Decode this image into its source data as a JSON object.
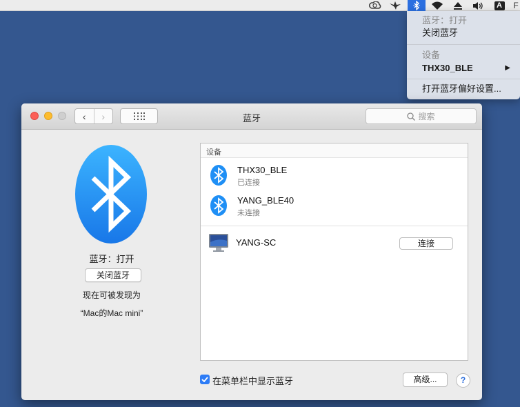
{
  "menubar": {
    "icons": [
      "creative-cloud-icon",
      "bird-icon",
      "bluetooth-icon",
      "wifi-icon",
      "eject-icon",
      "volume-icon",
      "input-source-icon"
    ],
    "input_source_label": "A",
    "extra_label": "F"
  },
  "dropdown": {
    "status": "蓝牙：打开",
    "toggle": "关闭蓝牙",
    "devices_header": "设备",
    "device": "THX30_BLE",
    "open_prefs": "打开蓝牙偏好设置..."
  },
  "window": {
    "title": "蓝牙",
    "search_placeholder": "搜索"
  },
  "left": {
    "status": "蓝牙：打开",
    "toggle_button": "关闭蓝牙",
    "discoverable_line1": "现在可被发现为",
    "discoverable_line2": "“Mac的Mac mini”"
  },
  "devices": {
    "header": "设备",
    "items": [
      {
        "name": "THX30_BLE",
        "status": "已连接"
      },
      {
        "name": "YANG_BLE40",
        "status": "未连接"
      }
    ],
    "computer": {
      "name": "YANG-SC",
      "action": "连接"
    }
  },
  "footer": {
    "show_in_menubar": "在菜单栏中显示蓝牙",
    "show_in_menubar_checked": true,
    "advanced_button": "高级...",
    "help_button": "?"
  },
  "colors": {
    "desktop": "#34578f",
    "bluetooth_blue": "#1f8ff5",
    "menubar_highlight": "#2b6fe0",
    "checkbox": "#2d7cf6"
  }
}
